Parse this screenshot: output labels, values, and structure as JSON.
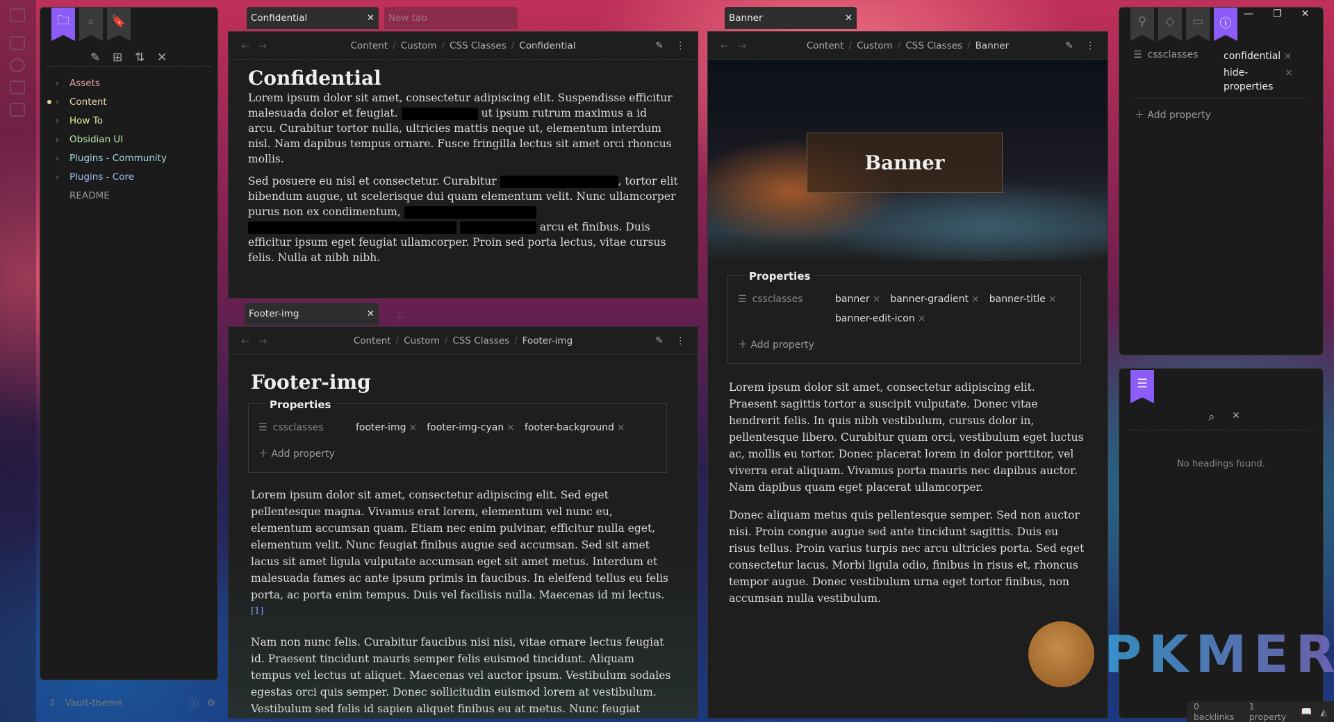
{
  "ribbon": {
    "icons": [
      "sidebar-toggle-icon",
      "file-search-icon",
      "graph-icon",
      "canvas-icon",
      "calendar-icon"
    ]
  },
  "sidebar": {
    "tabs": [
      "files-icon",
      "search-icon",
      "bookmark-icon"
    ],
    "toolbar": [
      "new-note-icon",
      "new-folder-icon",
      "sort-icon",
      "collapse-icon"
    ],
    "items": [
      {
        "label": "Assets",
        "color": "#e8a0a0",
        "folder": true
      },
      {
        "label": "Content",
        "color": "#f0d8a8",
        "folder": true,
        "active": true
      },
      {
        "label": "How To",
        "color": "#e8e8a0",
        "folder": true
      },
      {
        "label": "Obsidian UI",
        "color": "#b8e8a8",
        "folder": true
      },
      {
        "label": "Plugins - Community",
        "color": "#a0d8e0",
        "folder": true
      },
      {
        "label": "Plugins - Core",
        "color": "#a0b8f0",
        "folder": true
      },
      {
        "label": "README",
        "color": "#999999",
        "folder": false
      }
    ],
    "vault": "Vault-theme"
  },
  "tabs_left": {
    "active": "Confidential",
    "new": "New tab"
  },
  "confidential": {
    "breadcrumb": [
      "Content",
      "Custom",
      "CSS Classes",
      "Confidential"
    ],
    "title": "Confidential",
    "p1a": "Lorem ipsum dolor sit amet, consectetur adipiscing elit. Suspendisse efficitur malesuada dolor et feugiat.",
    "p1b": "ut ipsum rutrum maximus a id arcu. Curabitur tortor nulla, ultricies mattis neque ut, elementum interdum nisl. Nam dapibus tempus ornare. Fusce fringilla lectus sit amet orci rhoncus mollis.",
    "p2a": "Sed posuere eu nisl et consectetur. Curabitur",
    "p2b": ", tortor elit bibendum augue, ut scelerisque dui quam elementum velit. Nunc ullamcorper purus non ex condimentum,",
    "p2c": "arcu et finibus. Duis efficitur ipsum eget feugiat ullamcorper. Proin sed porta lectus, vitae cursus felis. Nulla at nibh nibh."
  },
  "tabs_footer": {
    "active": "Footer-img"
  },
  "footer": {
    "breadcrumb": [
      "Content",
      "Custom",
      "CSS Classes",
      "Footer-img"
    ],
    "title": "Footer-img",
    "properties_label": "Properties",
    "key": "cssclasses",
    "values": [
      "footer-img",
      "footer-img-cyan",
      "footer-background"
    ],
    "add": "Add property",
    "p1": "Lorem ipsum dolor sit amet, consectetur adipiscing elit. Sed eget pellentesque magna. Vivamus erat lorem, elementum vel nunc eu, elementum accumsan quam. Etiam nec enim pulvinar, efficitur nulla eget, elementum velit. Nunc feugiat finibus augue sed accumsan. Sed sit amet lacus sit amet ligula vulputate accumsan eget sit amet metus. Interdum et malesuada fames ac ante ipsum primis in faucibus. In eleifend tellus eu felis porta, ac porta enim tempus. Duis vel facilisis nulla. Maecenas id mi lectus.",
    "fn": "[1]",
    "p2": "Nam non nunc felis. Curabitur faucibus nisi nisi, vitae ornare lectus feugiat id. Praesent tincidunt mauris semper felis euismod tincidunt. Aliquam tempus vel lectus ut aliquet. Maecenas vel auctor ipsum. Vestibulum sodales egestas orci quis semper. Donec sollicitudin euismod lorem at vestibulum. Vestibulum sed felis id sapien aliquet finibus eu at metus. Nunc feugiat egestas nisi vitae tincidunt. Phasellus ut lectus id magna faucibus commodo. Suspendisse convallis faucibus"
  },
  "tabs_right": {
    "active": "Banner"
  },
  "banner": {
    "breadcrumb": [
      "Content",
      "Custom",
      "CSS Classes",
      "Banner"
    ],
    "title": "Banner",
    "properties_label": "Properties",
    "key": "cssclasses",
    "values": [
      "banner",
      "banner-gradient",
      "banner-title",
      "banner-edit-icon"
    ],
    "add": "Add property",
    "p1": "Lorem ipsum dolor sit amet, consectetur adipiscing elit. Praesent sagittis tortor a suscipit vulputate. Donec vitae hendrerit felis. In quis nibh vestibulum, cursus dolor in, pellentesque libero. Curabitur quam orci, vestibulum eget luctus ac, mollis eu tortor. Donec placerat lorem in dolor porttitor, vel viverra erat aliquam. Vivamus porta mauris nec dapibus auctor. Nam dapibus quam eget placerat ullamcorper.",
    "p2": "Donec aliquam metus quis pellentesque semper. Sed non auctor nisi. Proin congue augue sed ante tincidunt sagittis. Duis eu risus tellus. Proin varius turpis nec arcu ultricies porta. Sed eget consectetur lacus. Morbi ligula odio, finibus in risus et, rhoncus tempor augue. Donec vestibulum urna eget tortor finibus, non accumsan nulla vestibulum."
  },
  "right_panel": {
    "tabs": [
      "backlinks-icon",
      "tags-icon",
      "archive-icon",
      "info-icon"
    ],
    "key": "cssclasses",
    "values": [
      "confidential",
      "hide-properties"
    ],
    "add": "Add property",
    "outline_empty": "No headings found."
  },
  "status": {
    "backlinks": "0 backlinks",
    "properties": "1 property"
  },
  "watermark": "PKMER",
  "colors": {
    "accent": "#8b5cf6",
    "pane": "#1e1e1e"
  }
}
